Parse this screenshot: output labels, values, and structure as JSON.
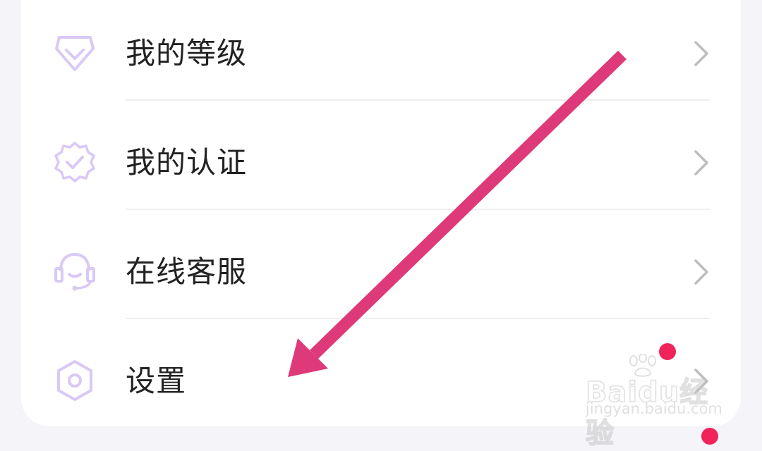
{
  "menu": {
    "items": [
      {
        "label": "我的等级",
        "icon": "diamond-icon"
      },
      {
        "label": "我的认证",
        "icon": "verified-badge-icon"
      },
      {
        "label": "在线客服",
        "icon": "headset-icon"
      },
      {
        "label": "设置",
        "icon": "settings-hexagon-icon",
        "has_red_dot": true
      }
    ]
  },
  "watermark": {
    "logo_text": "Baidu经验",
    "url": "jingyan.baidu.com"
  },
  "colors": {
    "icon_accent": "#d9c9f5",
    "arrow": "#de3a7a",
    "badge": "#f0245a",
    "chevron": "#bdbdbd"
  }
}
